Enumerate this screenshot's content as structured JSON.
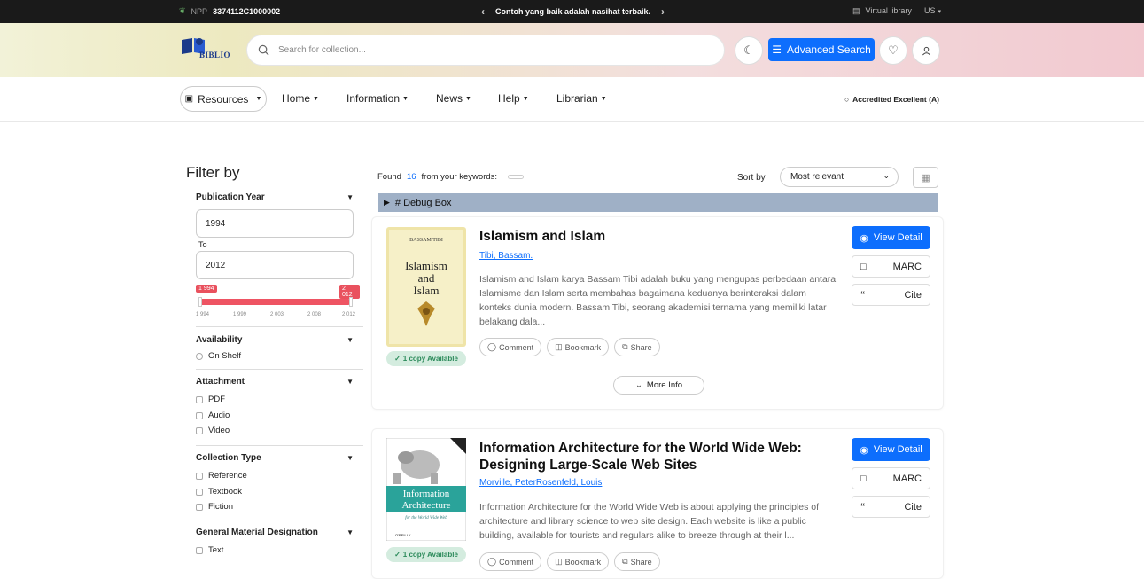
{
  "topbar": {
    "npp_label": "NPP",
    "npp_value": "3374112C1000002",
    "quote": "Contoh yang baik adalah nasihat terbaik.",
    "virtual_library": "Virtual library",
    "lang": "US"
  },
  "header": {
    "logo_text": "BIBLIO",
    "search_placeholder": "Search for collection...",
    "advanced_search": "Advanced Search"
  },
  "nav": {
    "resources": "Resources",
    "items": [
      "Home",
      "Information",
      "News",
      "Help",
      "Librarian"
    ],
    "accreditation": "Accredited Excellent (A)"
  },
  "filter": {
    "title": "Filter by",
    "pub_year_label": "Publication Year",
    "from_year": "1994",
    "to_label": "To",
    "to_year": "2012",
    "slider_min_label": "1 994",
    "slider_max_label": "2 012",
    "slider_ticks": [
      "1 994",
      "1 999",
      "2 003",
      "2 008",
      "2 012"
    ],
    "availability": {
      "label": "Availability",
      "options": [
        "On Shelf"
      ]
    },
    "attachment": {
      "label": "Attachment",
      "options": [
        "PDF",
        "Audio",
        "Video"
      ]
    },
    "collection_type": {
      "label": "Collection Type",
      "options": [
        "Reference",
        "Textbook",
        "Fiction"
      ]
    },
    "gmd": {
      "label": "General Material Designation",
      "options": [
        "Text"
      ]
    }
  },
  "results": {
    "found_label": "Found",
    "count": "16",
    "from_keywords": "from your keywords:",
    "sort_label": "Sort by",
    "sort_value": "Most relevant",
    "debug_label": "# Debug Box"
  },
  "books": [
    {
      "title": "Islamism and Islam",
      "author": "Tibi, Bassam.",
      "cover_author": "BASSAM TIBI",
      "cover_title_1": "Islamism",
      "cover_title_2": "and",
      "cover_title_3": "Islam",
      "description": "Islamism and Islam karya Bassam Tibi adalah buku yang mengupas perbedaan antara Islamisme dan Islam serta membahas bagaimana keduanya berinteraksi dalam konteks dunia modern. Bassam Tibi, seorang akademisi ternama yang memiliki latar belakang dala...",
      "availability": "1 copy Available",
      "more_info": "More Info"
    },
    {
      "title": "Information Architecture for the World Wide Web: Designing Large-Scale Web Sites",
      "author": "Morville, PeterRosenfeld, Louis",
      "cover_title_1": "Information",
      "cover_title_2": "Architecture",
      "cover_sub": "for the World Wide Web",
      "cover_publisher": "O'REILLY",
      "description": "Information Architecture for the World Wide Web is about applying the principles of architecture and library science to web site design. Each website is like a public building, available for tourists and regulars alike to breeze through at their l...",
      "availability": "1 copy Available"
    }
  ],
  "card_actions": {
    "comment": "Comment",
    "bookmark": "Bookmark",
    "share": "Share",
    "view_detail": "View Detail",
    "marc": "MARC",
    "cite": "Cite"
  },
  "colors": {
    "primary": "#0d6efd",
    "slider": "#ee5463",
    "available_bg": "#d4ecdf",
    "available_text": "#2b8a5a",
    "debug_bg": "#9fb0c6"
  }
}
